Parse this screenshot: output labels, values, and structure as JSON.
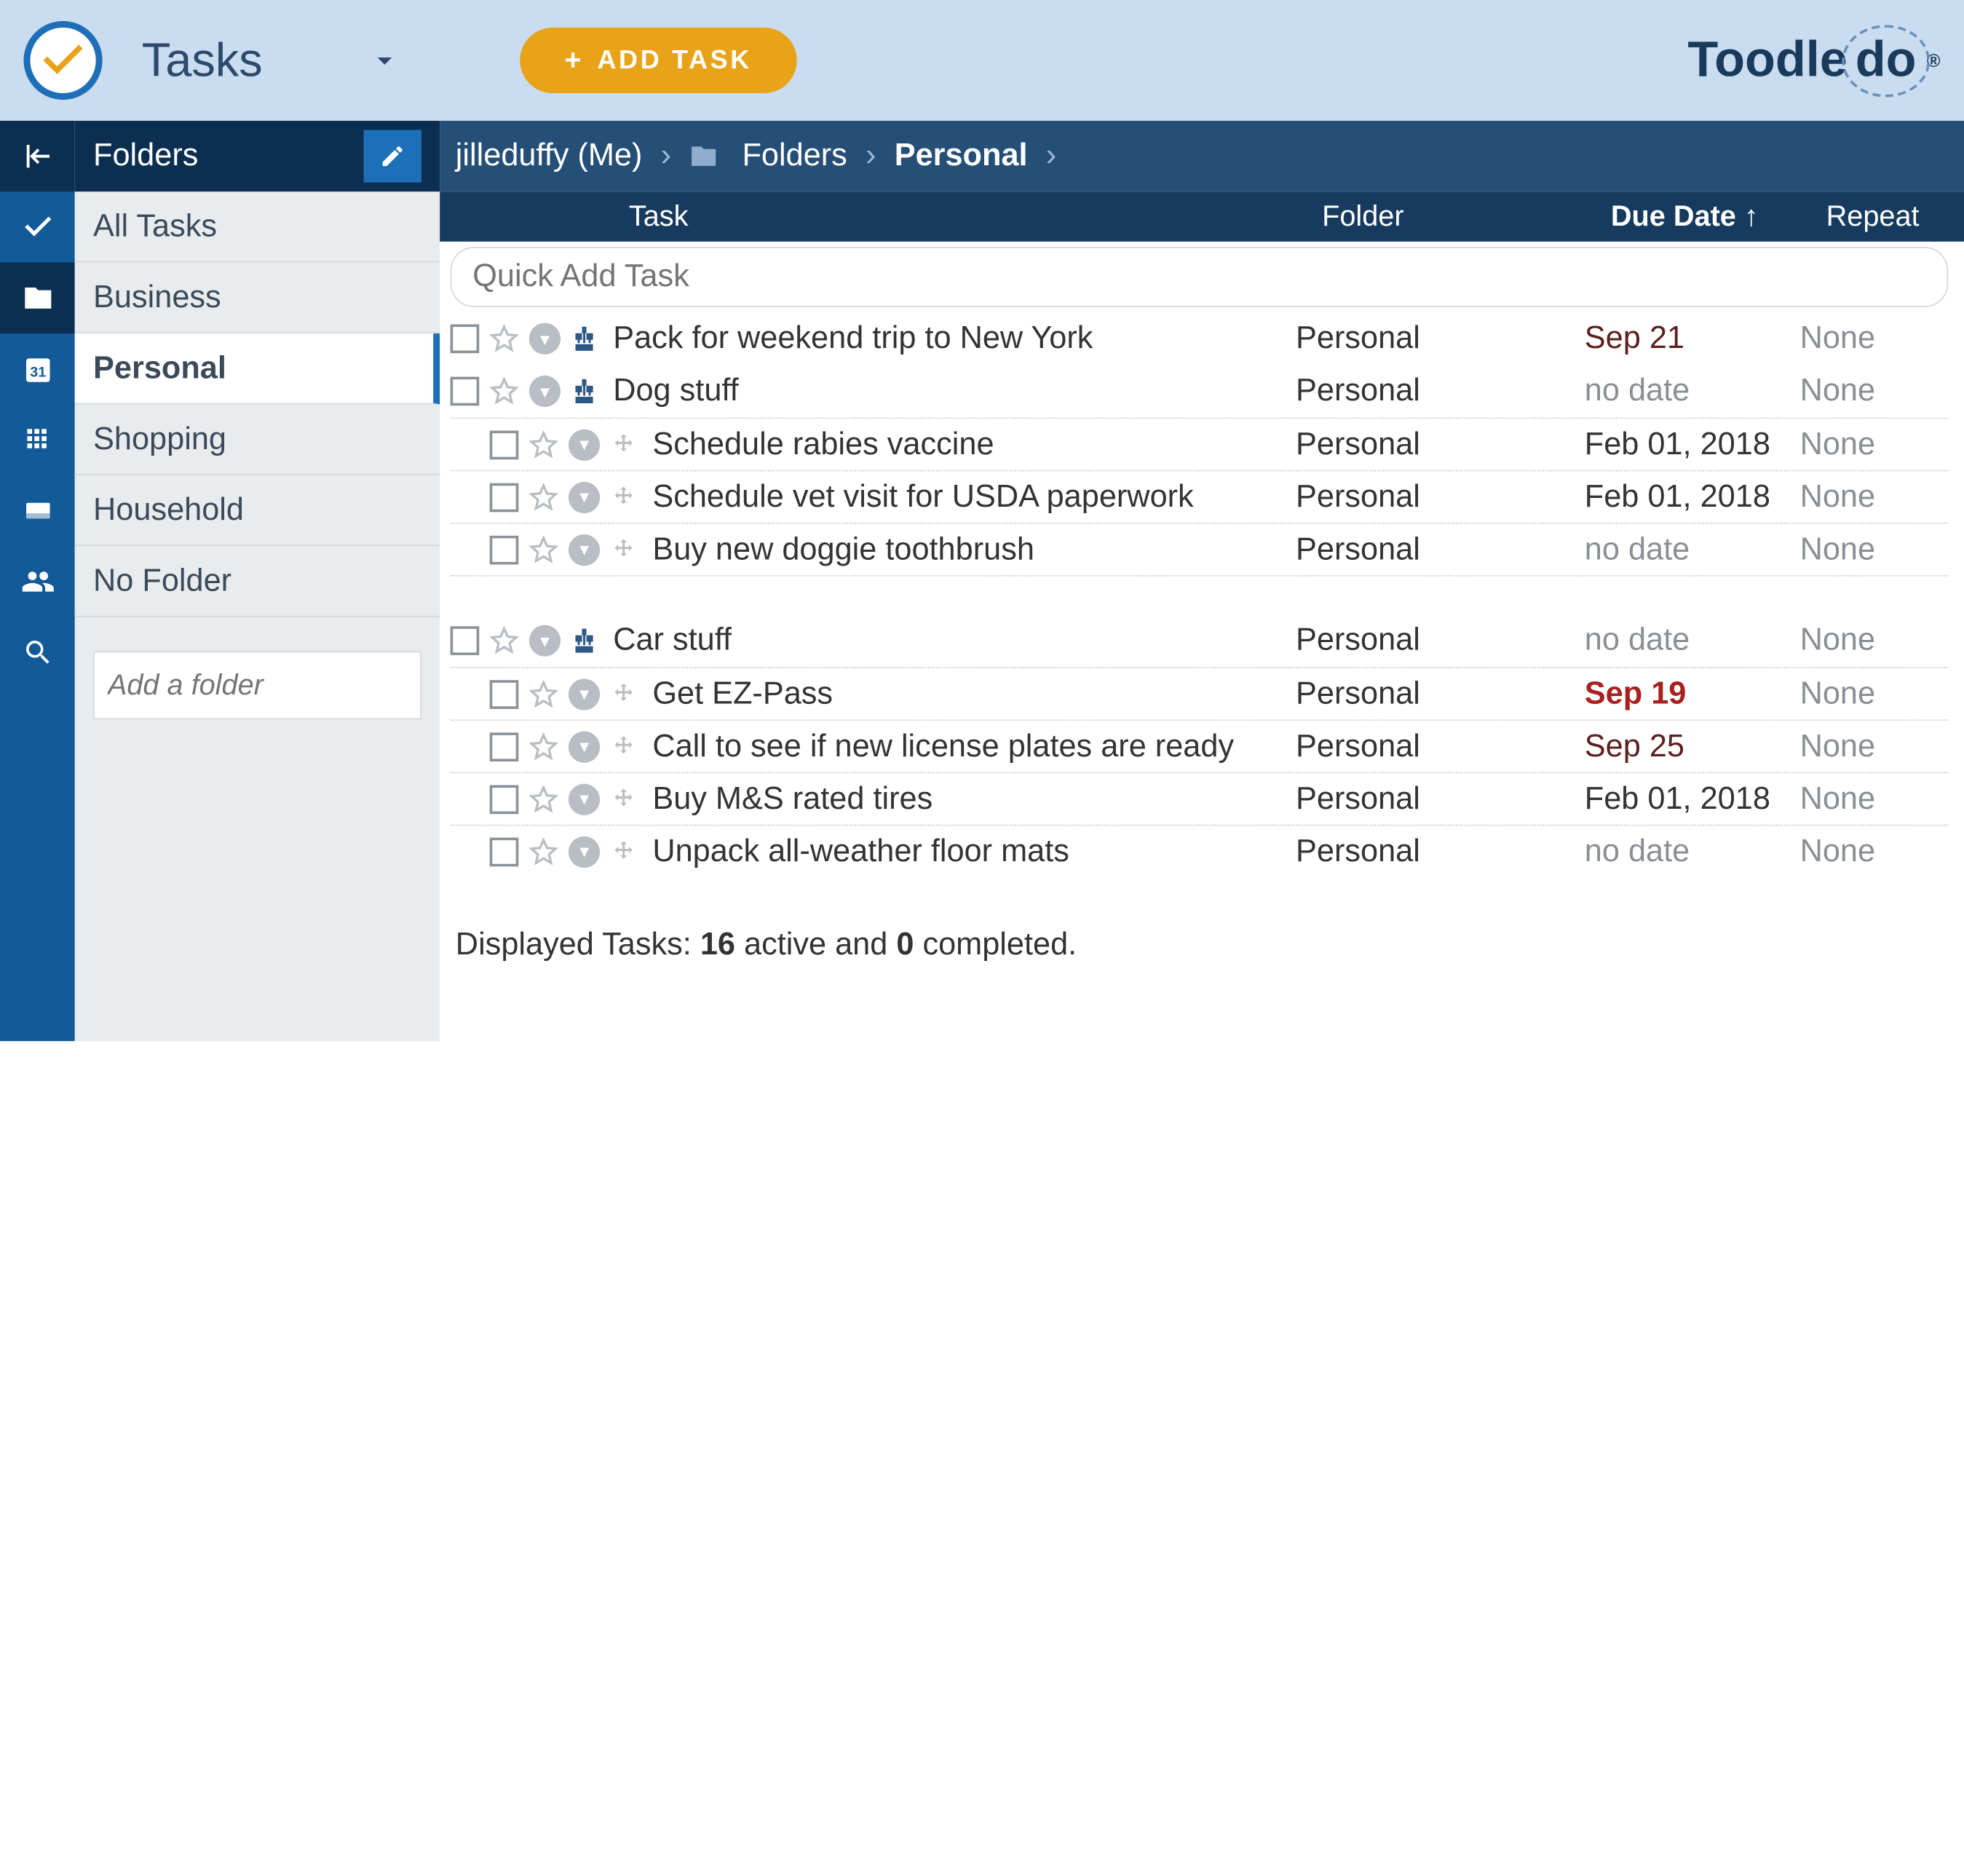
{
  "header": {
    "app_title": "Tasks",
    "add_task_label": "ADD TASK",
    "brand_prefix": "Toodle",
    "brand_suffix": "do"
  },
  "rail": {
    "items": [
      "collapse",
      "check",
      "folder",
      "calendar",
      "grid",
      "card",
      "people",
      "search"
    ]
  },
  "sidebar": {
    "title": "Folders",
    "items": [
      {
        "label": "All Tasks",
        "active": false
      },
      {
        "label": "Business",
        "active": false
      },
      {
        "label": "Personal",
        "active": true
      },
      {
        "label": "Shopping",
        "active": false
      },
      {
        "label": "Household",
        "active": false
      },
      {
        "label": "No Folder",
        "active": false
      }
    ],
    "add_folder_placeholder": "Add a folder"
  },
  "breadcrumb": {
    "user": "jilleduffy (Me)",
    "folders_label": "Folders",
    "current": "Personal"
  },
  "columns": {
    "task": "Task",
    "folder": "Folder",
    "due": "Due Date",
    "repeat": "Repeat",
    "sort_indicator": "↑"
  },
  "quick_add_placeholder": "Quick Add Task",
  "tasks": [
    {
      "title": "Pack for weekend trip to New York",
      "folder": "Personal",
      "due": "Sep 21",
      "due_style": "dark",
      "repeat": "None",
      "child": false,
      "icon": "tree"
    },
    {
      "title": "Dog stuff",
      "folder": "Personal",
      "due": "no date",
      "due_style": "nodate",
      "repeat": "None",
      "child": false,
      "icon": "tree"
    },
    {
      "title": "Schedule rabies vaccine",
      "folder": "Personal",
      "due": "Feb 01, 2018",
      "due_style": "",
      "repeat": "None",
      "child": true,
      "icon": "move"
    },
    {
      "title": "Schedule vet visit for USDA paperwork",
      "folder": "Personal",
      "due": "Feb 01, 2018",
      "due_style": "",
      "repeat": "None",
      "child": true,
      "icon": "move"
    },
    {
      "title": "Buy new doggie toothbrush",
      "folder": "Personal",
      "due": "no date",
      "due_style": "nodate",
      "repeat": "None",
      "child": true,
      "icon": "move"
    },
    {
      "gap": true
    },
    {
      "title": "Car stuff",
      "folder": "Personal",
      "due": "no date",
      "due_style": "nodate",
      "repeat": "None",
      "child": false,
      "icon": "tree"
    },
    {
      "title": "Get EZ-Pass",
      "folder": "Personal",
      "due": "Sep 19",
      "due_style": "red",
      "repeat": "None",
      "child": true,
      "icon": "move"
    },
    {
      "title": "Call to see if new license plates are ready",
      "folder": "Personal",
      "due": "Sep 25",
      "due_style": "dark",
      "repeat": "None",
      "child": true,
      "icon": "move"
    },
    {
      "title": "Buy M&S rated tires",
      "folder": "Personal",
      "due": "Feb 01, 2018",
      "due_style": "",
      "repeat": "None",
      "child": true,
      "icon": "move"
    },
    {
      "title": "Unpack all-weather floor mats",
      "folder": "Personal",
      "due": "no date",
      "due_style": "nodate",
      "repeat": "None",
      "child": true,
      "icon": "move"
    }
  ],
  "footer": {
    "prefix": "Displayed Tasks: ",
    "active": "16",
    "mid": " active and ",
    "completed": "0",
    "suffix": " completed."
  }
}
